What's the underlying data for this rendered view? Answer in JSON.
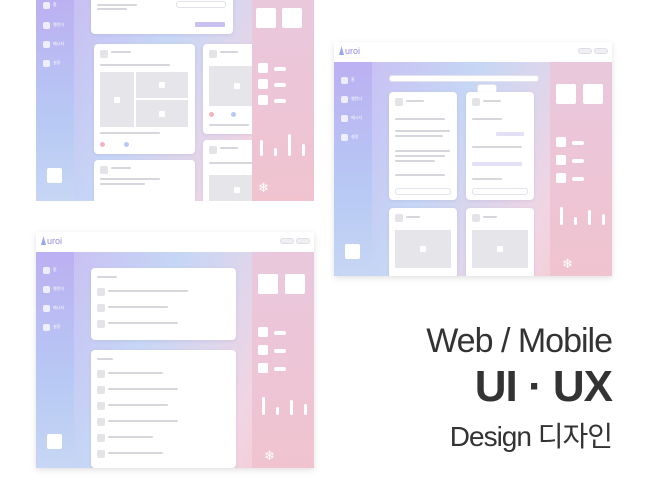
{
  "headline": {
    "line1": "Web / Mobile",
    "line2": "UI · UX",
    "line3": "Design 디자인"
  },
  "colors": {
    "headline_text": "#333333",
    "sidebar_gradient_top": "#bcb0f2",
    "panel_gradient": "#f0c3cf",
    "accent_purple": "#9a86e0"
  },
  "brand": {
    "logo": "uroi"
  },
  "sidebar_items": [
    "홈",
    "캘린더",
    "메시지",
    "설정"
  ],
  "icons": [
    "logo-mark",
    "home-icon",
    "calendar-icon",
    "message-icon",
    "settings-icon",
    "snowflake-icon",
    "image-placeholder-icon",
    "sun-icon",
    "moon-icon",
    "cloud-icon"
  ]
}
